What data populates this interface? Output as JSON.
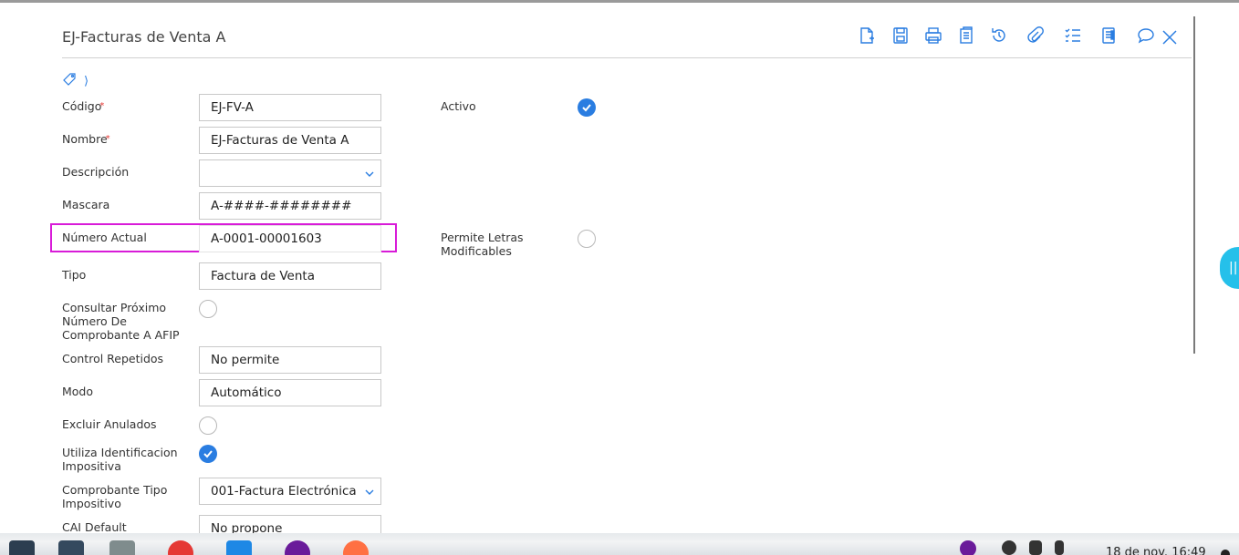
{
  "window": {
    "title": "EJ-Facturas de Venta A"
  },
  "toolbar": {
    "icons": [
      "new-document-icon",
      "save-icon",
      "print-icon",
      "report-icon",
      "refresh-icon",
      "attachment-icon",
      "checklist-icon",
      "export-icon",
      "chat-icon",
      "close-icon"
    ]
  },
  "form": {
    "codigo": {
      "label": "Código",
      "value": "EJ-FV-A",
      "required_mark": "*"
    },
    "nombre": {
      "label": "Nombre",
      "value": "EJ-Facturas de Venta A",
      "required_mark": "*"
    },
    "descripcion": {
      "label": "Descripción",
      "value": ""
    },
    "mascara": {
      "label": "Mascara",
      "value": "A-####-########"
    },
    "numero_actual": {
      "label": "Número Actual",
      "value": "A-0001-00001603"
    },
    "tipo": {
      "label": "Tipo",
      "value": "Factura de Venta"
    },
    "consultar_afip": {
      "label": "Consultar Próximo Número De Comprobante A AFIP",
      "checked": false
    },
    "control_repetidos": {
      "label": "Control Repetidos",
      "value": "No permite"
    },
    "modo": {
      "label": "Modo",
      "value": "Automático"
    },
    "excluir_anulados": {
      "label": "Excluir Anulados",
      "checked": false
    },
    "utiliza_identificacion": {
      "label": "Utiliza Identificacion Impositiva",
      "checked": true
    },
    "comprobante_tipo": {
      "label": "Comprobante Tipo Impositivo",
      "value": "001-Factura Electrónica"
    },
    "cai_default": {
      "label": "CAI Default",
      "value": "No propone"
    },
    "activo": {
      "label": "Activo",
      "checked": true
    },
    "permite_letras": {
      "label": "Permite Letras Modificables",
      "checked": false
    }
  },
  "taskbar": {
    "clock": "18 de nov. 16:49"
  },
  "colors": {
    "accent": "#2a7de1",
    "highlight": "#d81bd8",
    "side_tab": "#25c0ea"
  }
}
